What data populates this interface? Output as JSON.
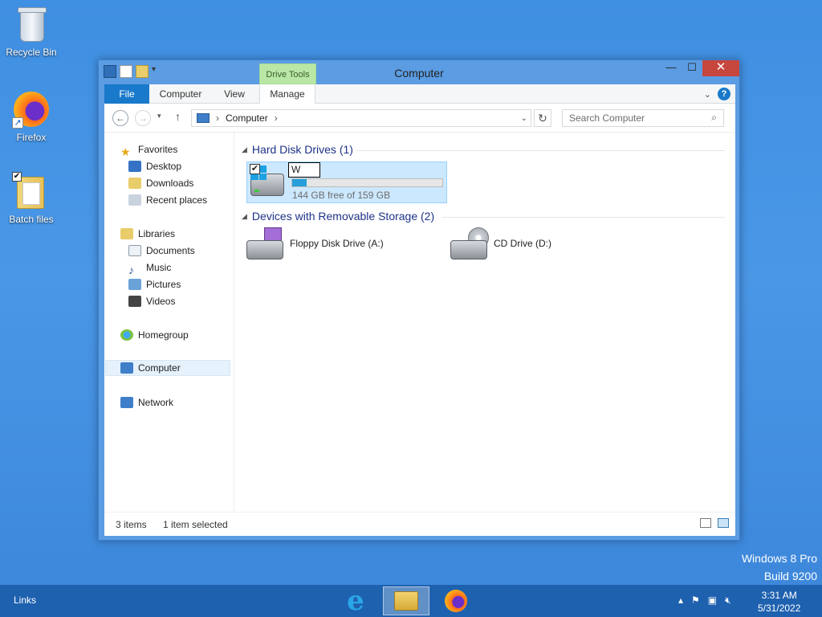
{
  "desktop": {
    "icons": [
      {
        "label": "Recycle Bin"
      },
      {
        "label": "Firefox"
      },
      {
        "label": "Batch files"
      }
    ]
  },
  "window": {
    "title": "Computer",
    "contextual_tab": "Drive Tools",
    "controls": {
      "minimize": "—",
      "maximize": "☐",
      "close": "✕"
    },
    "ribbon_tabs": [
      "File",
      "Computer",
      "View",
      "Manage"
    ],
    "address": {
      "crumb": "Computer",
      "arrow": "›"
    },
    "search_placeholder": "Search Computer"
  },
  "nav": {
    "favorites": "Favorites",
    "desktop": "Desktop",
    "downloads": "Downloads",
    "recent": "Recent places",
    "libraries": "Libraries",
    "documents": "Documents",
    "music": "Music",
    "pictures": "Pictures",
    "videos": "Videos",
    "homegroup": "Homegroup",
    "computer": "Computer",
    "network": "Network"
  },
  "main": {
    "group_hdd": "Hard Disk Drives (1)",
    "group_removable": "Devices with Removable Storage (2)",
    "drive_c": {
      "rename_text": "W",
      "free_text": "144 GB free of 159 GB",
      "used_fraction": 0.094,
      "checked": "✔"
    },
    "floppy": "Floppy Disk Drive (A:)",
    "cd": "CD Drive (D:)"
  },
  "status": {
    "items": "3 items",
    "selected": "1 item selected"
  },
  "watermark": {
    "line1": "Windows 8 Pro",
    "line2": "Build 9200"
  },
  "taskbar": {
    "links": "Links",
    "time": "3:31 AM",
    "date": "5/31/2022"
  },
  "colors": {
    "desktop": "#3f8fe2",
    "file_tab": "#1979ca",
    "selection": "#cce8ff",
    "drive_tools": "#b9e8a6"
  }
}
